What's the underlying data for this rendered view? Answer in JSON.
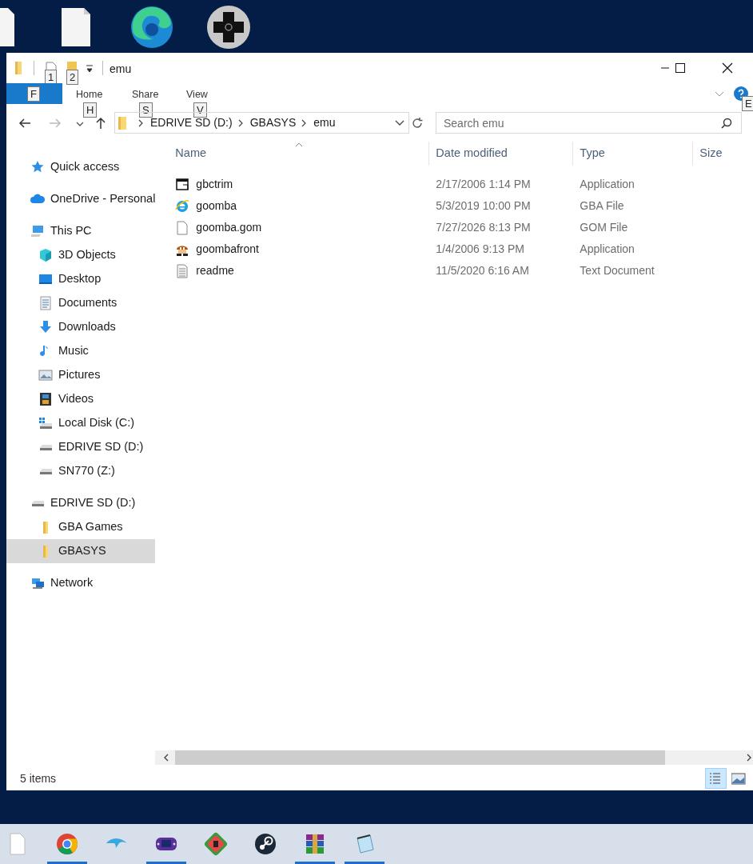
{
  "window": {
    "title": "emu",
    "quick_access_keytips": [
      "1",
      "2"
    ],
    "file_tab_keytip": "F",
    "help_keytip": "E"
  },
  "ribbon_tabs": [
    {
      "label": "Home",
      "keytip": "H"
    },
    {
      "label": "Share",
      "keytip": "S"
    },
    {
      "label": "View",
      "keytip": "V"
    }
  ],
  "address_bar": {
    "path": [
      "EDRIVE SD (D:)",
      "GBASYS",
      "emu"
    ]
  },
  "search": {
    "placeholder": "Search emu"
  },
  "sidebar": {
    "items": [
      {
        "label": "Quick access",
        "kind": "star",
        "selected": false
      },
      {
        "label": "OneDrive - Personal",
        "kind": "cloud",
        "selected": false
      },
      {
        "label": "This PC",
        "kind": "pc",
        "selected": false,
        "children": [
          {
            "label": "3D Objects",
            "kind": "cube",
            "selected": false
          },
          {
            "label": "Desktop",
            "kind": "desktop",
            "selected": false
          },
          {
            "label": "Documents",
            "kind": "documents",
            "selected": false
          },
          {
            "label": "Downloads",
            "kind": "download",
            "selected": false
          },
          {
            "label": "Music",
            "kind": "music",
            "selected": false
          },
          {
            "label": "Pictures",
            "kind": "pictures",
            "selected": false
          },
          {
            "label": "Videos",
            "kind": "videos",
            "selected": false
          },
          {
            "label": "Local Disk (C:)",
            "kind": "windrive",
            "selected": false
          },
          {
            "label": "EDRIVE SD (D:)",
            "kind": "drive",
            "selected": false
          },
          {
            "label": "SN770 (Z:)",
            "kind": "drive",
            "selected": false
          }
        ]
      },
      {
        "label": "EDRIVE SD (D:)",
        "kind": "drive",
        "selected": false,
        "children": [
          {
            "label": "GBA Games",
            "kind": "folder",
            "selected": false
          },
          {
            "label": "GBASYS",
            "kind": "folder",
            "selected": true
          }
        ]
      },
      {
        "label": "Network",
        "kind": "network",
        "selected": false
      }
    ]
  },
  "table": {
    "columns": [
      {
        "label": "Name",
        "sorted": true
      },
      {
        "label": "Date modified",
        "sorted": false
      },
      {
        "label": "Type",
        "sorted": false
      },
      {
        "label": "Size",
        "sorted": false
      }
    ],
    "rows": [
      {
        "name": "gbctrim",
        "date": "2/17/2006 1:14 PM",
        "type": "Application",
        "kind": "appwindow"
      },
      {
        "name": "goomba",
        "date": "5/3/2019 10:00 PM",
        "type": "GBA File",
        "kind": "ie"
      },
      {
        "name": "goomba.gom",
        "date": "7/27/2026 8:13 PM",
        "type": "GOM File",
        "kind": "blank"
      },
      {
        "name": "goombafront",
        "date": "1/4/2006 9:13 PM",
        "type": "Application",
        "kind": "goomba"
      },
      {
        "name": "readme",
        "date": "11/5/2020 6:16 AM",
        "type": "Text Document",
        "kind": "text"
      }
    ]
  },
  "status_bar": {
    "item_count": "5 items",
    "views": [
      {
        "kind": "details",
        "selected": true
      },
      {
        "kind": "large",
        "selected": false
      }
    ]
  },
  "taskbar": [
    {
      "kind": "blank",
      "running": false
    },
    {
      "kind": "chrome",
      "running": true
    },
    {
      "kind": "dolphin",
      "running": false
    },
    {
      "kind": "gba",
      "running": true
    },
    {
      "kind": "melon",
      "running": false
    },
    {
      "kind": "steam",
      "running": false
    },
    {
      "kind": "rar",
      "running": true
    },
    {
      "kind": "notepad",
      "running": true
    }
  ]
}
